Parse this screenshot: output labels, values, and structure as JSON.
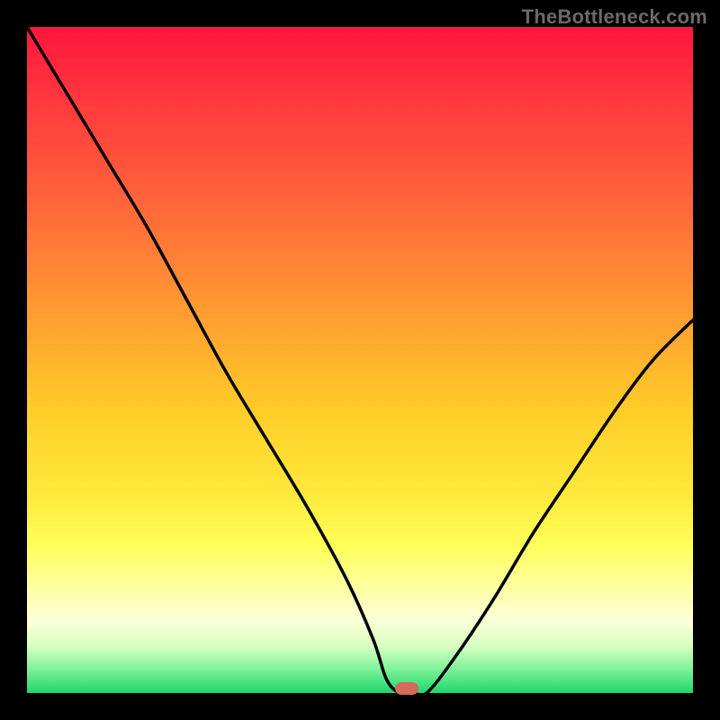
{
  "attribution": "TheBottleneck.com",
  "colors": {
    "background": "#000000",
    "attribution_text": "#6a6a6a",
    "curve_stroke": "#000000",
    "marker_fill": "#d46a5a"
  },
  "chart_data": {
    "type": "line",
    "title": "",
    "xlabel": "",
    "ylabel": "",
    "xlim": [
      0,
      100
    ],
    "ylim": [
      0,
      100
    ],
    "series": [
      {
        "name": "bottleneck-curve",
        "x": [
          0,
          6,
          12,
          18,
          24,
          30,
          36,
          42,
          48,
          52,
          54,
          56,
          58,
          60,
          64,
          70,
          76,
          82,
          88,
          94,
          100
        ],
        "y": [
          100,
          90,
          80,
          70,
          59,
          48,
          38,
          28,
          17,
          8,
          2,
          0,
          0,
          0,
          5,
          14,
          24,
          33,
          42,
          50,
          56
        ]
      }
    ],
    "annotations": [
      {
        "name": "min-marker",
        "x": 57,
        "y": 0.7,
        "color": "#d46a5a"
      }
    ],
    "gradient_stops": [
      {
        "pos": 0.0,
        "color": "#ff163e"
      },
      {
        "pos": 0.28,
        "color": "#ff6a3a"
      },
      {
        "pos": 0.58,
        "color": "#ffce28"
      },
      {
        "pos": 0.84,
        "color": "#ffffa0"
      },
      {
        "pos": 1.0,
        "color": "#1fd66b"
      }
    ]
  }
}
